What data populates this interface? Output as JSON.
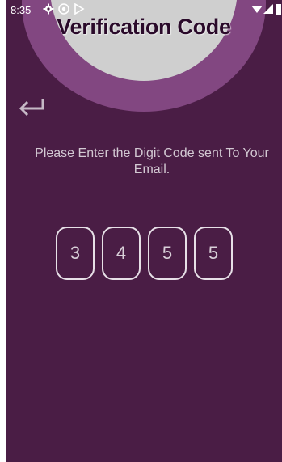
{
  "status_bar": {
    "time": "8:35",
    "left_icons": [
      "gear-icon",
      "cast-icon",
      "play-store-icon"
    ],
    "right_icons": [
      "wifi-icon",
      "signal-icon",
      "battery-icon"
    ]
  },
  "header": {
    "title": "Verification Code"
  },
  "back_button": {
    "icon": "return-arrow-icon"
  },
  "instruction": {
    "text": "Please Enter the Digit Code sent To Your Email."
  },
  "code": {
    "digits": [
      "3",
      "4",
      "5",
      "5"
    ]
  },
  "colors": {
    "background": "#4a1d45",
    "arc_outer": "#824781",
    "arc_inner": "#cfcfcf",
    "title_text": "#2a0a2a",
    "text_muted": "#d3c9d3",
    "box_border": "#e7e0e7"
  }
}
